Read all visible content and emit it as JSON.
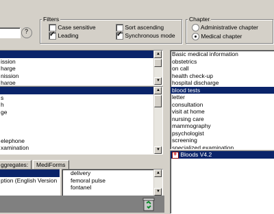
{
  "filters": {
    "legend": "Filters",
    "case_sensitive": "Case sensitive",
    "leading": "Leading",
    "sort_ascending": "Sort ascending",
    "synchronous_mode": "Synchronous mode"
  },
  "chapter": {
    "legend": "Chapter",
    "administrative": "Administrative chapter",
    "medical": "Medical chapter"
  },
  "left_list_top": {
    "items": [
      "",
      "ission",
      "harge",
      "nission",
      "harge"
    ]
  },
  "left_list_mid": {
    "items": [
      "",
      "s",
      "h",
      "ge",
      "",
      "",
      "",
      "elephone",
      "xamination"
    ]
  },
  "right_list": {
    "items": [
      "Basic medical information",
      "obstetrics",
      "on call",
      "health check-up",
      "hospital discharge",
      "blood tests",
      "letter",
      "consultation",
      "visit at home",
      "nursing care",
      "mammography",
      "psychologist",
      "screening",
      "specialized examination"
    ],
    "selected_index": 5
  },
  "right_bottom": {
    "item": "Bloods V4.2"
  },
  "tabs": {
    "aggregates": "ggregates:",
    "mediforms": "MediForms"
  },
  "bottom_left_list": {
    "items": [
      "",
      "ption (English Version",
      ""
    ]
  },
  "bottom_mid_list": {
    "items": [
      "delivery",
      "femoral pulse",
      "fontanel"
    ]
  }
}
